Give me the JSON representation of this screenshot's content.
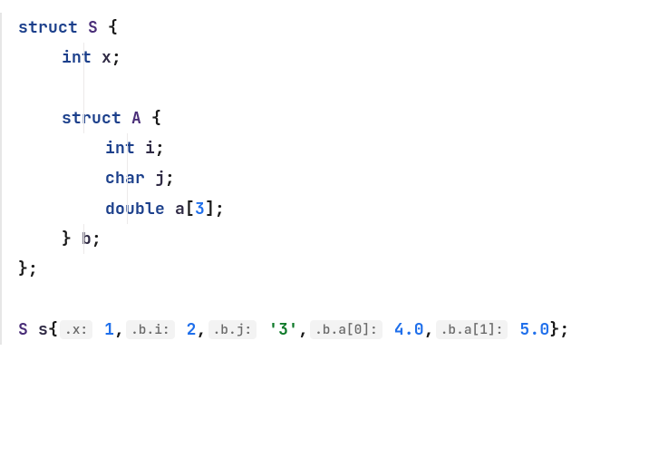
{
  "code": {
    "kw_struct": "struct",
    "name_S": "S",
    "brace_open": "{",
    "kw_int": "int",
    "field_x": "x",
    "semi": ";",
    "name_A": "A",
    "field_i": "i",
    "kw_char": "char",
    "field_j": "j",
    "kw_double": "double",
    "field_a": "a",
    "bracket_open": "[",
    "arr_size": "3",
    "bracket_close": "]",
    "brace_close": "}",
    "field_b": "b",
    "type_S": "S",
    "var_s": "s",
    "hint_x": ".x:",
    "val_1": "1",
    "comma": ",",
    "hint_bi": ".b.i:",
    "val_2": "2",
    "hint_bj": ".b.j:",
    "val_3": "'3'",
    "hint_ba0": ".b.a[0]:",
    "val_40": "4.0",
    "hint_ba1": ".b.a[1]:",
    "val_50": "5.0"
  },
  "chart_data": {
    "type": "table",
    "description": "C++ braced aggregate initialization with IDE inlay hints showing member paths",
    "struct_S": {
      "x": "int",
      "b": {
        "struct": "A",
        "i": "int",
        "j": "char",
        "a": "double[3]"
      }
    },
    "initialization": {
      "variable": "s",
      "type": "S",
      "members": [
        {
          "path": ".x",
          "value": 1
        },
        {
          "path": ".b.i",
          "value": 2
        },
        {
          "path": ".b.j",
          "value": "'3'"
        },
        {
          "path": ".b.a[0]",
          "value": 4.0
        },
        {
          "path": ".b.a[1]",
          "value": 5.0
        }
      ]
    }
  }
}
